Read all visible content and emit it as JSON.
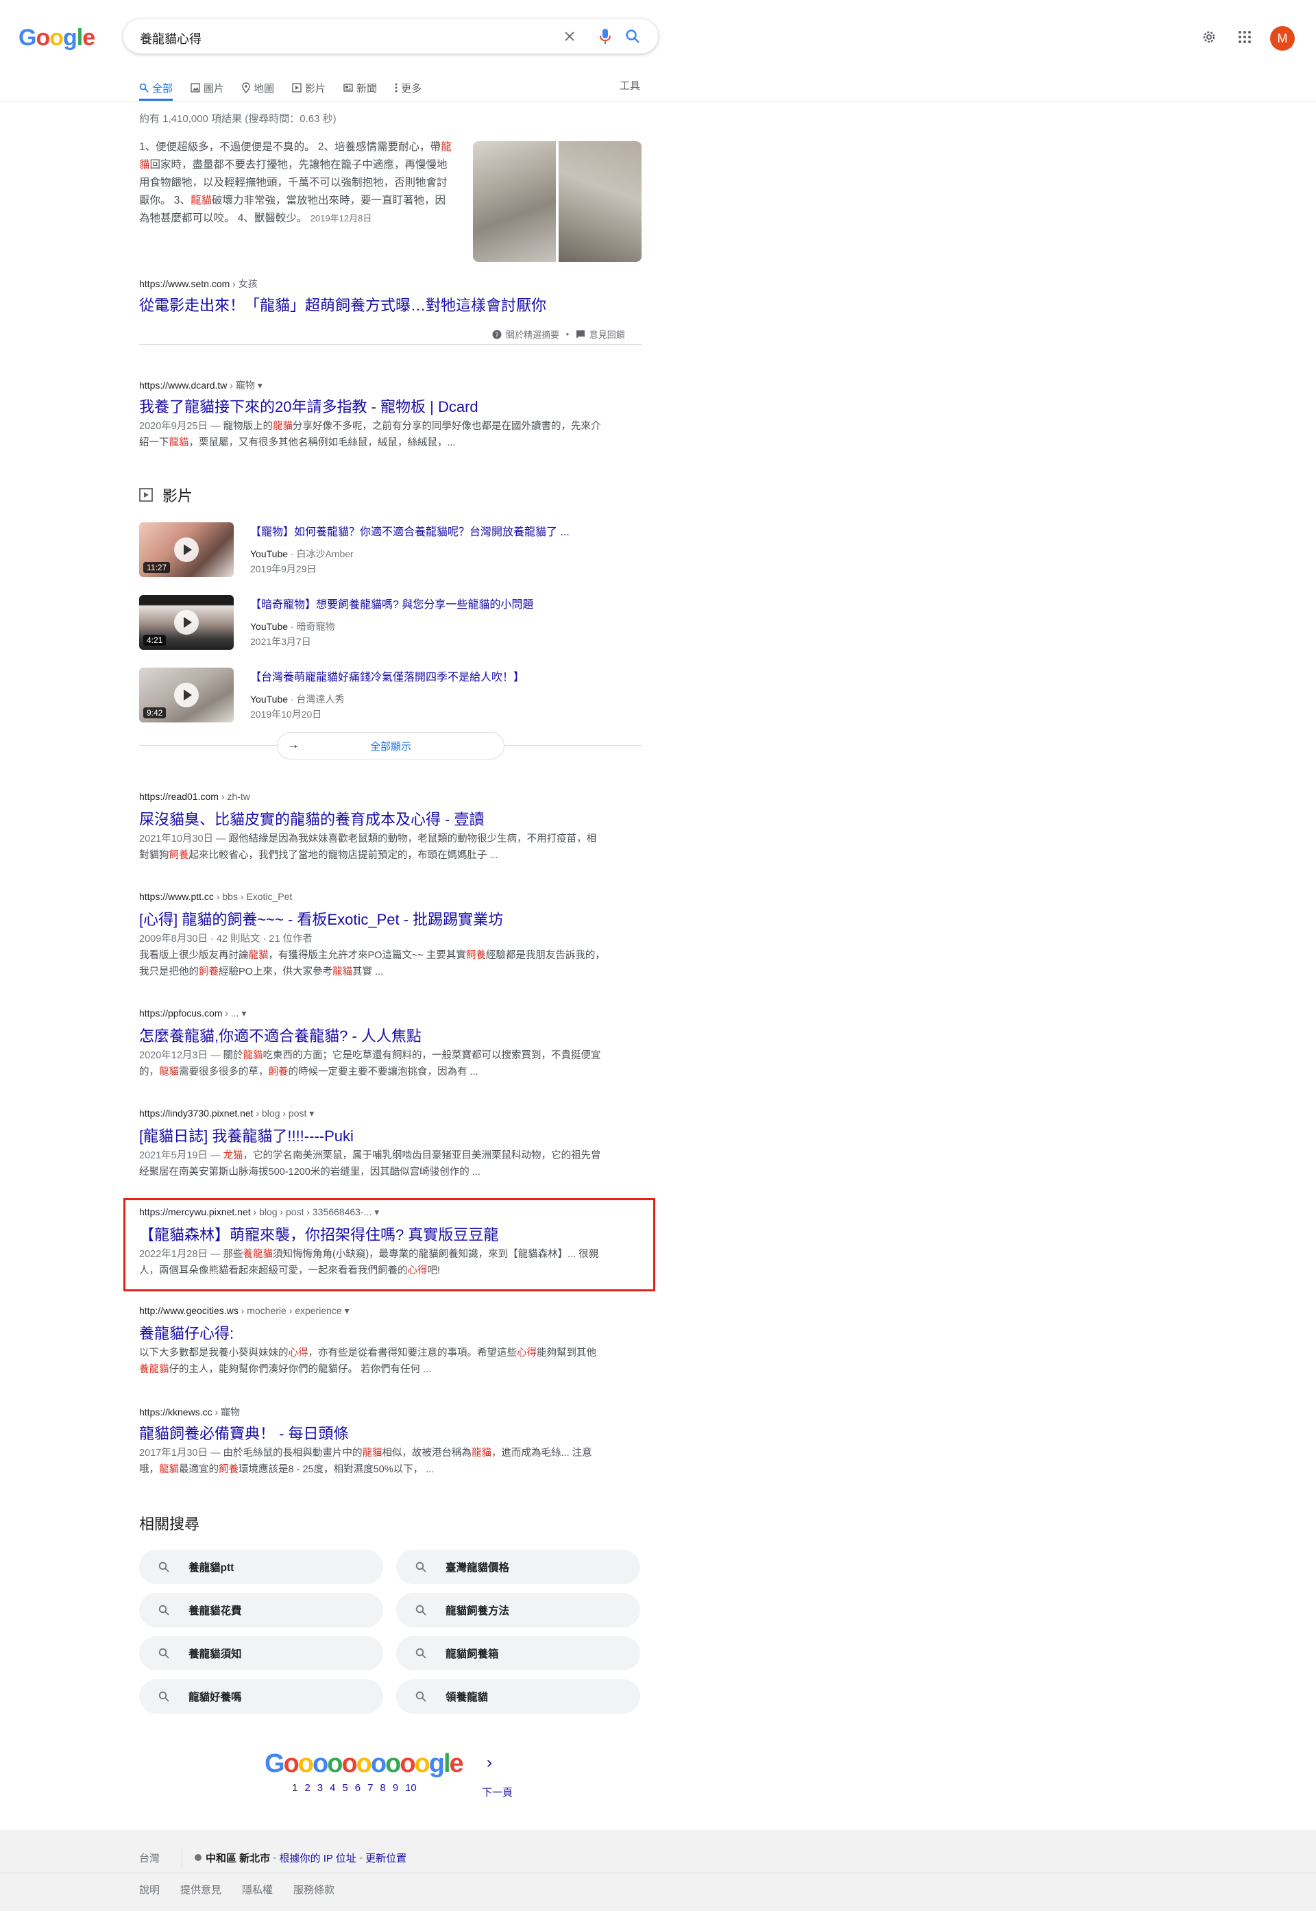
{
  "header": {
    "logo": "Google",
    "query": "養龍貓心得",
    "avatar_letter": "M",
    "accent": "#1a73e8",
    "avatar_color": "#e64a19"
  },
  "tabs": [
    {
      "label": "全部",
      "icon": "search-icon",
      "active": true
    },
    {
      "label": "圖片",
      "icon": "image-icon"
    },
    {
      "label": "地圖",
      "icon": "map-pin-icon"
    },
    {
      "label": "影片",
      "icon": "video-icon"
    },
    {
      "label": "新聞",
      "icon": "news-icon"
    },
    {
      "label": "更多",
      "icon": "more-icon"
    }
  ],
  "tools": "工具",
  "stats": "約有 1,410,000 項結果 (搜尋時間：0.63 秒)",
  "featured": {
    "parts": [
      {
        "t": "1、便便超級多，不過便便是不臭的。 2、培養感情需要耐心，帶"
      },
      {
        "t": "龍貓",
        "hl": true
      },
      {
        "t": "回家時，盡量都不要去打擾牠，先讓牠在籠子中適應，再慢慢地用食物餵牠，以及輕輕撫牠頭，千萬不可以強制抱牠，否則牠會討厭你。 3、"
      },
      {
        "t": "龍貓",
        "hl": true
      },
      {
        "t": "破壞力非常強，當放牠出來時，要一直盯著牠，因為牠甚麼都可以咬。 4、獸醫較少。"
      }
    ],
    "date": "2019年12月8日",
    "url": "https://www.setn.com",
    "crumb": "› 女孩",
    "title": "從電影走出來！「龍貓」超萌飼養方式曝…對牠這樣會討厭你",
    "about": "關於精選摘要",
    "feedback": "意見回饋"
  },
  "results": [
    {
      "url": "https://www.dcard.tw",
      "crumb": "› 寵物",
      "title": "我養了龍貓接下來的20年請多指教 - 寵物板 | Dcard",
      "desc": [
        {
          "t": "2020年9月25日 — ",
          "d": true
        },
        {
          "t": "寵物版上的"
        },
        {
          "t": "龍貓",
          "hl": true
        },
        {
          "t": "分享好像不多呢，之前有分享的同學好像也都是在國外讀書的，先來介紹一下"
        },
        {
          "t": "龍貓",
          "hl": true
        },
        {
          "t": "，栗鼠屬，又有很多其他名稱例如毛絲鼠，絨鼠，絲絨鼠，..."
        }
      ]
    },
    {
      "url": "https://read01.com",
      "crumb": "› zh-tw",
      "title": "屎沒貓臭、比貓皮實的龍貓的養育成本及心得 - 壹讀",
      "desc": [
        {
          "t": "2021年10月30日 — ",
          "d": true
        },
        {
          "t": "跟他結緣是因為我妹妹喜歡老鼠類的動物，老鼠類的動物很少生病，不用打疫苗，相對貓狗"
        },
        {
          "t": "飼養",
          "hl": true
        },
        {
          "t": "起來比較省心，我們找了當地的寵物店提前預定的，布頭在媽媽肚子 ..."
        }
      ]
    },
    {
      "url": "https://www.ptt.cc",
      "crumb": "› bbs › Exotic_Pet",
      "title": "[心得] 龍貓的飼養~~~ - 看板Exotic_Pet - 批踢踢實業坊",
      "meta": "2009年8月30日 · 42 則貼文 · 21 位作者",
      "desc": [
        {
          "t": "我看版上很少版友再討論"
        },
        {
          "t": "龍貓",
          "hl": true
        },
        {
          "t": "，有獲得版主允許才來PO這篇文~~ 主要其實"
        },
        {
          "t": "飼養",
          "hl": true
        },
        {
          "t": "經驗都是我朋友告訴我的，我只是把他的"
        },
        {
          "t": "飼養",
          "hl": true
        },
        {
          "t": "經驗PO上來，供大家參考"
        },
        {
          "t": "龍貓",
          "hl": true
        },
        {
          "t": "其實 ..."
        }
      ]
    },
    {
      "url": "https://ppfocus.com",
      "crumb": "› ...",
      "title": "怎麼養龍貓,你適不適合養龍貓? - 人人焦點",
      "desc": [
        {
          "t": "2020年12月3日 — ",
          "d": true
        },
        {
          "t": "關於"
        },
        {
          "t": "龍貓",
          "hl": true
        },
        {
          "t": "吃東西的方面；它是吃草還有飼料的，一般菜寶都可以搜索買到，不貴挺便宜的，"
        },
        {
          "t": "龍貓",
          "hl": true
        },
        {
          "t": "需要很多很多的草，"
        },
        {
          "t": "飼養",
          "hl": true
        },
        {
          "t": "的時候一定要主要不要讓泡挑食，因為有 ..."
        }
      ]
    },
    {
      "url": "https://lindy3730.pixnet.net",
      "crumb": "› blog › post",
      "title": "[龍貓日誌] 我養龍貓了!!!!----Puki",
      "desc": [
        {
          "t": "2021年5月19日 — ",
          "d": true
        },
        {
          "t": "龙猫",
          "hl": true
        },
        {
          "t": "，它的学名南美洲栗鼠，属于哺乳纲啮齿目豪猪亚目美洲栗鼠科动物，它的祖先曾经聚居在南美安第斯山脉海拔500-1200米的岩缝里，因其酷似宫崎骏创作的 ..."
        }
      ]
    },
    {
      "url": "https://mercywu.pixnet.net",
      "crumb": "› blog › post › 335668463-...",
      "title": "【龍貓森林】萌寵來襲，你招架得住嗎? 真實版豆豆龍",
      "desc": [
        {
          "t": "2022年1月28日 — ",
          "d": true
        },
        {
          "t": "那些"
        },
        {
          "t": "養龍貓",
          "hl": true
        },
        {
          "t": "須知悔悔角角(小缺窺)，最專業的龍貓飼養知識，來到【龍貓森林】... 很親人，兩個耳朵像熊貓看起來超級可愛，一起來看看我們飼養的"
        },
        {
          "t": "心得",
          "hl": true
        },
        {
          "t": "吧!"
        }
      ]
    },
    {
      "url": "http://www.geocities.ws",
      "crumb": "› mocherie › experience",
      "title": "養龍貓仔心得:",
      "desc": [
        {
          "t": "以下大多數都是我養小葵與妹妹的"
        },
        {
          "t": "心得",
          "hl": true
        },
        {
          "t": "，亦有些是從看書得知要注意的事項。希望這些"
        },
        {
          "t": "心得",
          "hl": true
        },
        {
          "t": "能夠幫到其他"
        },
        {
          "t": "養龍貓",
          "hl": true
        },
        {
          "t": "仔的主人，能夠幫你們湊好你們的龍貓仔。 若你們有任何 ..."
        }
      ]
    },
    {
      "url": "https://kknews.cc",
      "crumb": "› 寵物",
      "title": "龍貓飼養必備寶典！ - 每日頭條",
      "desc": [
        {
          "t": "2017年1月30日 — ",
          "d": true
        },
        {
          "t": "由於毛絲鼠的長相與動畫片中的"
        },
        {
          "t": "龍貓",
          "hl": true
        },
        {
          "t": "相似，故被港台稱為"
        },
        {
          "t": "龍貓",
          "hl": true
        },
        {
          "t": "，進而成為毛絲... 注意哦，"
        },
        {
          "t": "龍貓",
          "hl": true
        },
        {
          "t": "最適宜的"
        },
        {
          "t": "飼養",
          "hl": true
        },
        {
          "t": "環境應該是8 - 25度，相對濕度50%以下， ..."
        }
      ]
    }
  ],
  "videos": {
    "heading": "影片",
    "items": [
      {
        "title": "【寵物】如何養龍貓？你適不適合養龍貓呢？台灣開放養龍貓了 ...",
        "source": "YouTube",
        "channel": "· 白冰沙Amber",
        "date": "2019年9月29日",
        "duration": "11:27"
      },
      {
        "title": "【暗奇寵物】想要飼養龍貓嗎? 與您分享一些龍貓的小問題",
        "source": "YouTube",
        "channel": "· 暗奇寵物",
        "date": "2021年3月7日",
        "duration": "4:21"
      },
      {
        "title": "【台灣養萌寵龍貓好痛錢冷氣僅落開四季不是給人吹！】",
        "source": "YouTube",
        "channel": "· 台灣達人秀",
        "date": "2019年10月20日",
        "duration": "9:42"
      }
    ],
    "show_all": "全部顯示"
  },
  "related": {
    "heading": "相關搜尋",
    "items": [
      "養龍貓ptt",
      "臺灣龍貓價格",
      "養龍貓花費",
      "龍貓飼養方法",
      "養龍貓須知",
      "龍貓飼養箱",
      "龍貓好養嗎",
      "領養龍貓"
    ]
  },
  "pagination": {
    "logo": "Goooooooooogle",
    "pages": [
      "1",
      "2",
      "3",
      "4",
      "5",
      "6",
      "7",
      "8",
      "9",
      "10"
    ],
    "next": "下一頁"
  },
  "footer": {
    "country": "台灣",
    "location": "中和區 新北市",
    "sep": " - ",
    "ip_link": "根據你的 IP 位址",
    "update_link": "更新位置",
    "links": [
      "說明",
      "提供意見",
      "隱私權",
      "服務條款"
    ]
  }
}
